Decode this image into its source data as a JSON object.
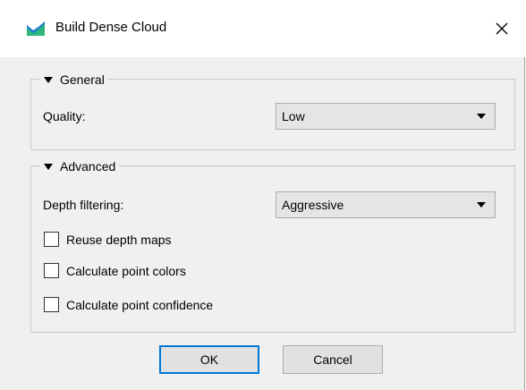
{
  "window": {
    "title": "Build Dense Cloud",
    "icon": "cloud-app-icon",
    "close_glyph": "close-icon"
  },
  "general": {
    "heading": "General",
    "quality_label": "Quality:",
    "quality_value": "Low"
  },
  "advanced": {
    "heading": "Advanced",
    "depth_filtering_label": "Depth filtering:",
    "depth_filtering_value": "Aggressive",
    "checkboxes": [
      {
        "label": "Reuse depth maps",
        "checked": false
      },
      {
        "label": "Calculate point colors",
        "checked": false
      },
      {
        "label": "Calculate point confidence",
        "checked": false
      }
    ]
  },
  "buttons": {
    "ok": "OK",
    "cancel": "Cancel"
  },
  "colors": {
    "accent": "#0078d7",
    "icon_green": "#2fb67c",
    "icon_blue": "#1f7fd0"
  }
}
